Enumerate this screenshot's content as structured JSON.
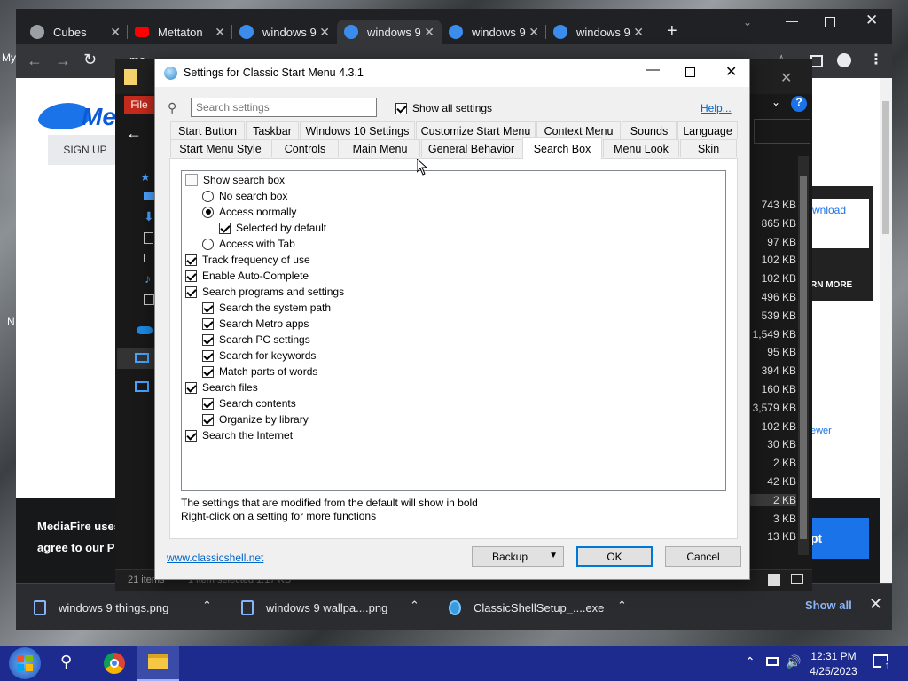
{
  "desktop": {
    "partial_text_1": "My",
    "partial_text_2": "N"
  },
  "chrome": {
    "tabs": [
      {
        "label": "Cubes",
        "icon": "globe-icon",
        "color": "#9aa0a6"
      },
      {
        "label": "Mettaton",
        "icon": "youtube-icon",
        "color": "#ff0000"
      },
      {
        "label": "windows 9",
        "icon": "mediafire-icon",
        "color": "#3b8ded"
      },
      {
        "label": "windows 9",
        "icon": "mediafire-icon",
        "color": "#3b8ded"
      },
      {
        "label": "windows 9",
        "icon": "mediafire-icon",
        "color": "#3b8ded"
      },
      {
        "label": "windows 9",
        "icon": "mediafire-icon",
        "color": "#3b8ded"
      }
    ],
    "new_tab": "+",
    "address_partial": "me"
  },
  "webpage": {
    "logo_text": "Me",
    "sign_up": "SIGN UP",
    "cookie_line1": "MediaFire uses",
    "cookie_line2": "agree to our Pr",
    "right_download": "wnload",
    "right_learn_more": "RN MORE",
    "right_viewer": "ewer",
    "right_accept": "pt"
  },
  "explorer": {
    "file_tab": "File",
    "status_count": "21 items",
    "status_sel": "1 item selected  1.17 KB",
    "sizes": [
      "743 KB",
      "865 KB",
      "97 KB",
      "102 KB",
      "102 KB",
      "496 KB",
      "539 KB",
      "1,549 KB",
      "95 KB",
      "394 KB",
      "160 KB",
      "3,579 KB",
      "102 KB",
      "30 KB",
      "2 KB",
      "42 KB",
      "2 KB",
      "3 KB",
      "13 KB"
    ]
  },
  "dialog": {
    "title": "Settings for Classic Start Menu 4.3.1",
    "search_placeholder": "Search settings",
    "show_all": "Show all settings",
    "help": "Help...",
    "tabs_row1": [
      "Start Button",
      "Taskbar",
      "Windows 10 Settings",
      "Customize Start Menu",
      "Context Menu",
      "Sounds",
      "Language"
    ],
    "tabs_row2": [
      "Start Menu Style",
      "Controls",
      "Main Menu",
      "General Behavior",
      "Search Box",
      "Menu Look",
      "Skin"
    ],
    "active_tab": "Search Box",
    "tree": [
      {
        "label": "Show search box",
        "kind": "header",
        "indent": 0
      },
      {
        "label": "No search box",
        "kind": "radio",
        "checked": false,
        "indent": 1
      },
      {
        "label": "Access normally",
        "kind": "radio",
        "checked": true,
        "indent": 1
      },
      {
        "label": "Selected by default",
        "kind": "check",
        "checked": true,
        "indent": 2
      },
      {
        "label": "Access with Tab",
        "kind": "radio",
        "checked": false,
        "indent": 1
      },
      {
        "label": "Track frequency of use",
        "kind": "check",
        "checked": true,
        "indent": 0
      },
      {
        "label": "Enable Auto-Complete",
        "kind": "check",
        "checked": true,
        "indent": 0
      },
      {
        "label": "Search programs and settings",
        "kind": "check",
        "checked": true,
        "indent": 0
      },
      {
        "label": "Search the system path",
        "kind": "check",
        "checked": true,
        "indent": 1
      },
      {
        "label": "Search Metro apps",
        "kind": "check",
        "checked": true,
        "indent": 1
      },
      {
        "label": "Search PC settings",
        "kind": "check",
        "checked": true,
        "indent": 1
      },
      {
        "label": "Search for keywords",
        "kind": "check",
        "checked": true,
        "indent": 1
      },
      {
        "label": "Match parts of words",
        "kind": "check",
        "checked": true,
        "indent": 1
      },
      {
        "label": "Search files",
        "kind": "check",
        "checked": true,
        "indent": 0
      },
      {
        "label": "Search contents",
        "kind": "check",
        "checked": true,
        "indent": 1
      },
      {
        "label": "Organize by library",
        "kind": "check",
        "checked": true,
        "indent": 1
      },
      {
        "label": "Search the Internet",
        "kind": "check",
        "checked": true,
        "indent": 0
      }
    ],
    "hint1": "The settings that are modified from the default will show in bold",
    "hint2": "Right-click on a setting for more functions",
    "link": "www.classicshell.net",
    "backup": "Backup",
    "ok": "OK",
    "cancel": "Cancel"
  },
  "downloads": {
    "items": [
      "windows 9 things.png",
      "windows 9 wallpa....png",
      "ClassicShellSetup_....exe"
    ],
    "show_all": "Show all"
  },
  "taskbar": {
    "time": "12:31 PM",
    "date": "4/25/2023",
    "notif_count": "1"
  }
}
